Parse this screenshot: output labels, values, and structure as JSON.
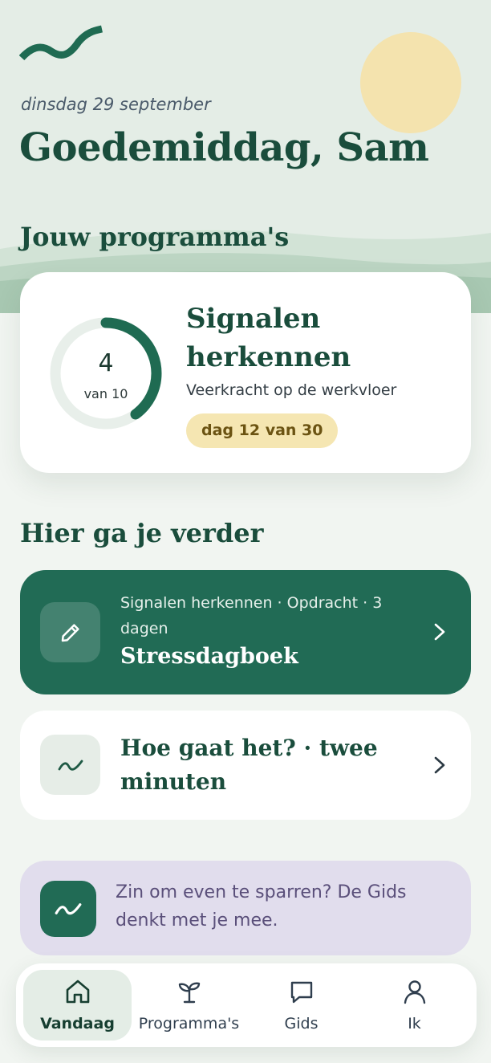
{
  "header": {
    "date": "dinsdag 29 september",
    "greeting": "Goedemiddag, Sam"
  },
  "programs": {
    "section_title": "Jouw programma's",
    "card": {
      "progress_value": "4",
      "progress_label": "van 10",
      "progress_fraction": 0.4,
      "title": "Signalen herkennen",
      "subtitle": "Veerkracht op de werkvloer",
      "badge": "dag 12 van 30"
    }
  },
  "continue": {
    "section_title": "Hier ga je verder",
    "task": {
      "meta": "Signalen herkennen · Opdracht · 3 dagen",
      "title": "Stressdagboek",
      "icon": "pencil-icon"
    },
    "checkin": {
      "title": "Hoe gaat het? · twee minuten",
      "icon": "wave-icon"
    }
  },
  "gids_prompt": {
    "text": "Zin om even te sparren? De Gids denkt met je mee.",
    "icon": "wave-icon"
  },
  "tabs": [
    {
      "label": "Vandaag",
      "icon": "home-icon",
      "active": true
    },
    {
      "label": "Programma's",
      "icon": "sprout-icon",
      "active": false
    },
    {
      "label": "Gids",
      "icon": "chat-icon",
      "active": false
    },
    {
      "label": "Ik",
      "icon": "user-icon",
      "active": false
    }
  ],
  "colors": {
    "brand_green": "#216b55",
    "dark_green": "#1a4d3c",
    "sun": "#f4e3ae",
    "badge_bg": "#f5e6b2",
    "gids_bg": "#e1dded"
  }
}
